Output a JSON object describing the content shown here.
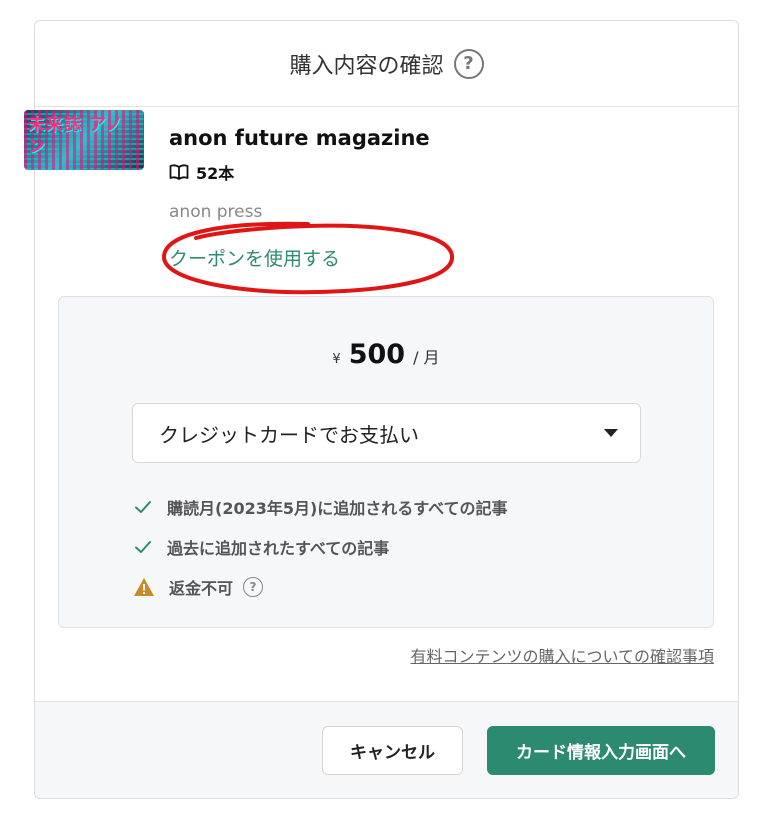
{
  "dialog": {
    "title": "購入内容の確認",
    "help_icon": "question-circle-icon"
  },
  "product": {
    "thumbnail_text": "未来誌 アノン",
    "name": "anon future magazine",
    "book_icon": "open-book-icon",
    "article_count": "52本",
    "publisher": "anon press",
    "coupon_label": "クーポンを使用する"
  },
  "price": {
    "currency": "¥",
    "amount": "500",
    "per": "/ 月"
  },
  "payment": {
    "selected": "クレジットカードでお支払い"
  },
  "features": [
    {
      "icon": "check-icon",
      "text": "購読月(2023年5月)に追加されるすべての記事"
    },
    {
      "icon": "check-icon",
      "text": "過去に追加されたすべての記事"
    },
    {
      "icon": "warning-icon",
      "text": "返金不可"
    }
  ],
  "terms_link": "有料コンテンツの購入についての確認事項",
  "buttons": {
    "cancel": "キャンセル",
    "next": "カード情報入力画面へ"
  },
  "colors": {
    "accent": "#2b8a6f",
    "link": "#2e8a74",
    "annotation": "#e01616",
    "warning": "#c98a2b"
  }
}
